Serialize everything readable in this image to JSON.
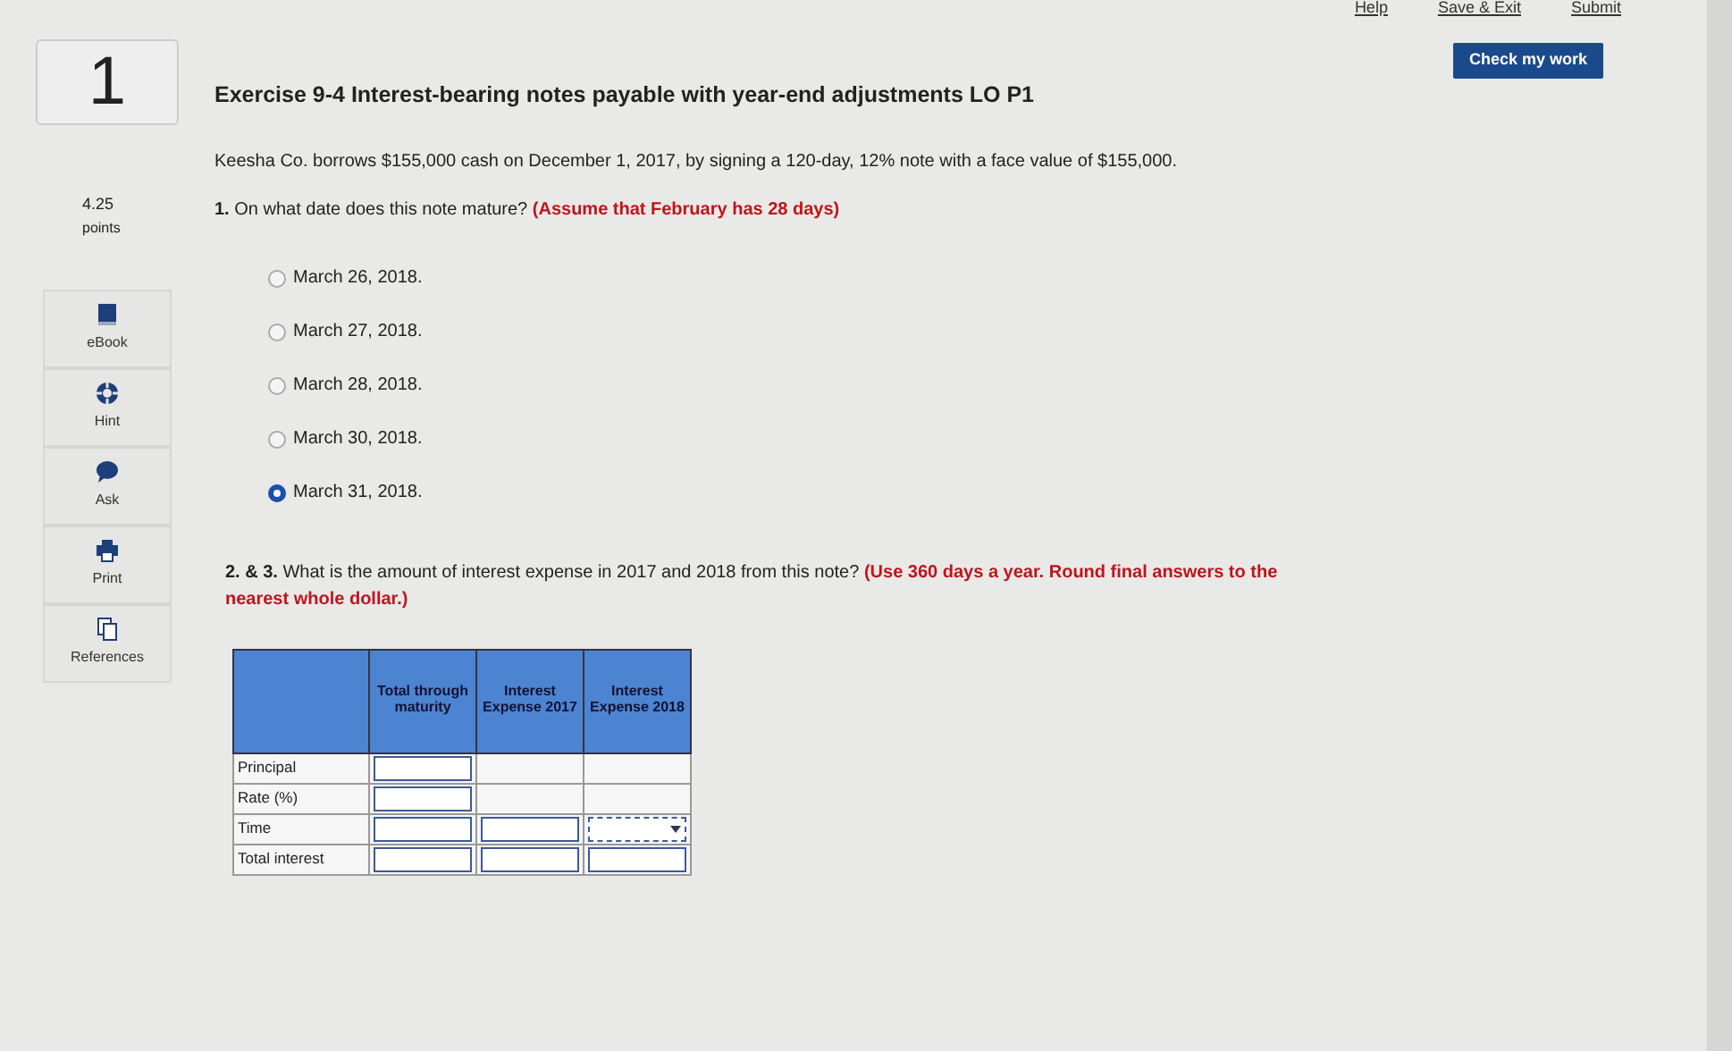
{
  "top_links": [
    "Help",
    "Save & Exit",
    "Submit"
  ],
  "question_number": "1",
  "points": {
    "value": "4.25",
    "label": "points"
  },
  "tools": [
    {
      "kind": "ebook",
      "label": "eBook"
    },
    {
      "kind": "hint",
      "label": "Hint"
    },
    {
      "kind": "ask",
      "label": "Ask"
    },
    {
      "kind": "print",
      "label": "Print"
    },
    {
      "kind": "references",
      "label": "References"
    }
  ],
  "check_button": "Check my work",
  "title": "Exercise 9-4 Interest-bearing notes payable with year-end adjustments LO P1",
  "intro": "Keesha Co. borrows $155,000 cash on December 1, 2017, by signing a 120-day, 12% note with a face value of $155,000.",
  "question_1": "**1.** On what date does this note mature? ",
  "question_1_note": "(Assume that February has 28 days)",
  "options": [
    {
      "label": "March 26, 2018.",
      "selected": false
    },
    {
      "label": "March 27, 2018.",
      "selected": false
    },
    {
      "label": "March 28, 2018.",
      "selected": false
    },
    {
      "label": "March 30, 2018.",
      "selected": false
    },
    {
      "label": "March 31, 2018.",
      "selected": true
    }
  ],
  "question_2": "**2. & 3.** What is the amount of interest expense in 2017 and 2018 from this note? ",
  "question_2_note": "(Use 360 days a year. Round final answers to the nearest whole dollar.)",
  "table": {
    "columns": [
      "Total through maturity",
      "Interest Expense 2017",
      "Interest Expense 2018"
    ],
    "rows": [
      {
        "label": "Principal",
        "cells": [
          {
            "kind": "input"
          },
          {
            "kind": "blank"
          },
          {
            "kind": "blank"
          }
        ]
      },
      {
        "label": "Rate (%)",
        "cells": [
          {
            "kind": "input"
          },
          {
            "kind": "blank"
          },
          {
            "kind": "blank"
          }
        ]
      },
      {
        "label": "Time",
        "cells": [
          {
            "kind": "input"
          },
          {
            "kind": "input"
          },
          {
            "kind": "select"
          }
        ]
      },
      {
        "label": "Total interest",
        "cells": [
          {
            "kind": "input"
          },
          {
            "kind": "input"
          },
          {
            "kind": "input"
          }
        ]
      }
    ]
  }
}
